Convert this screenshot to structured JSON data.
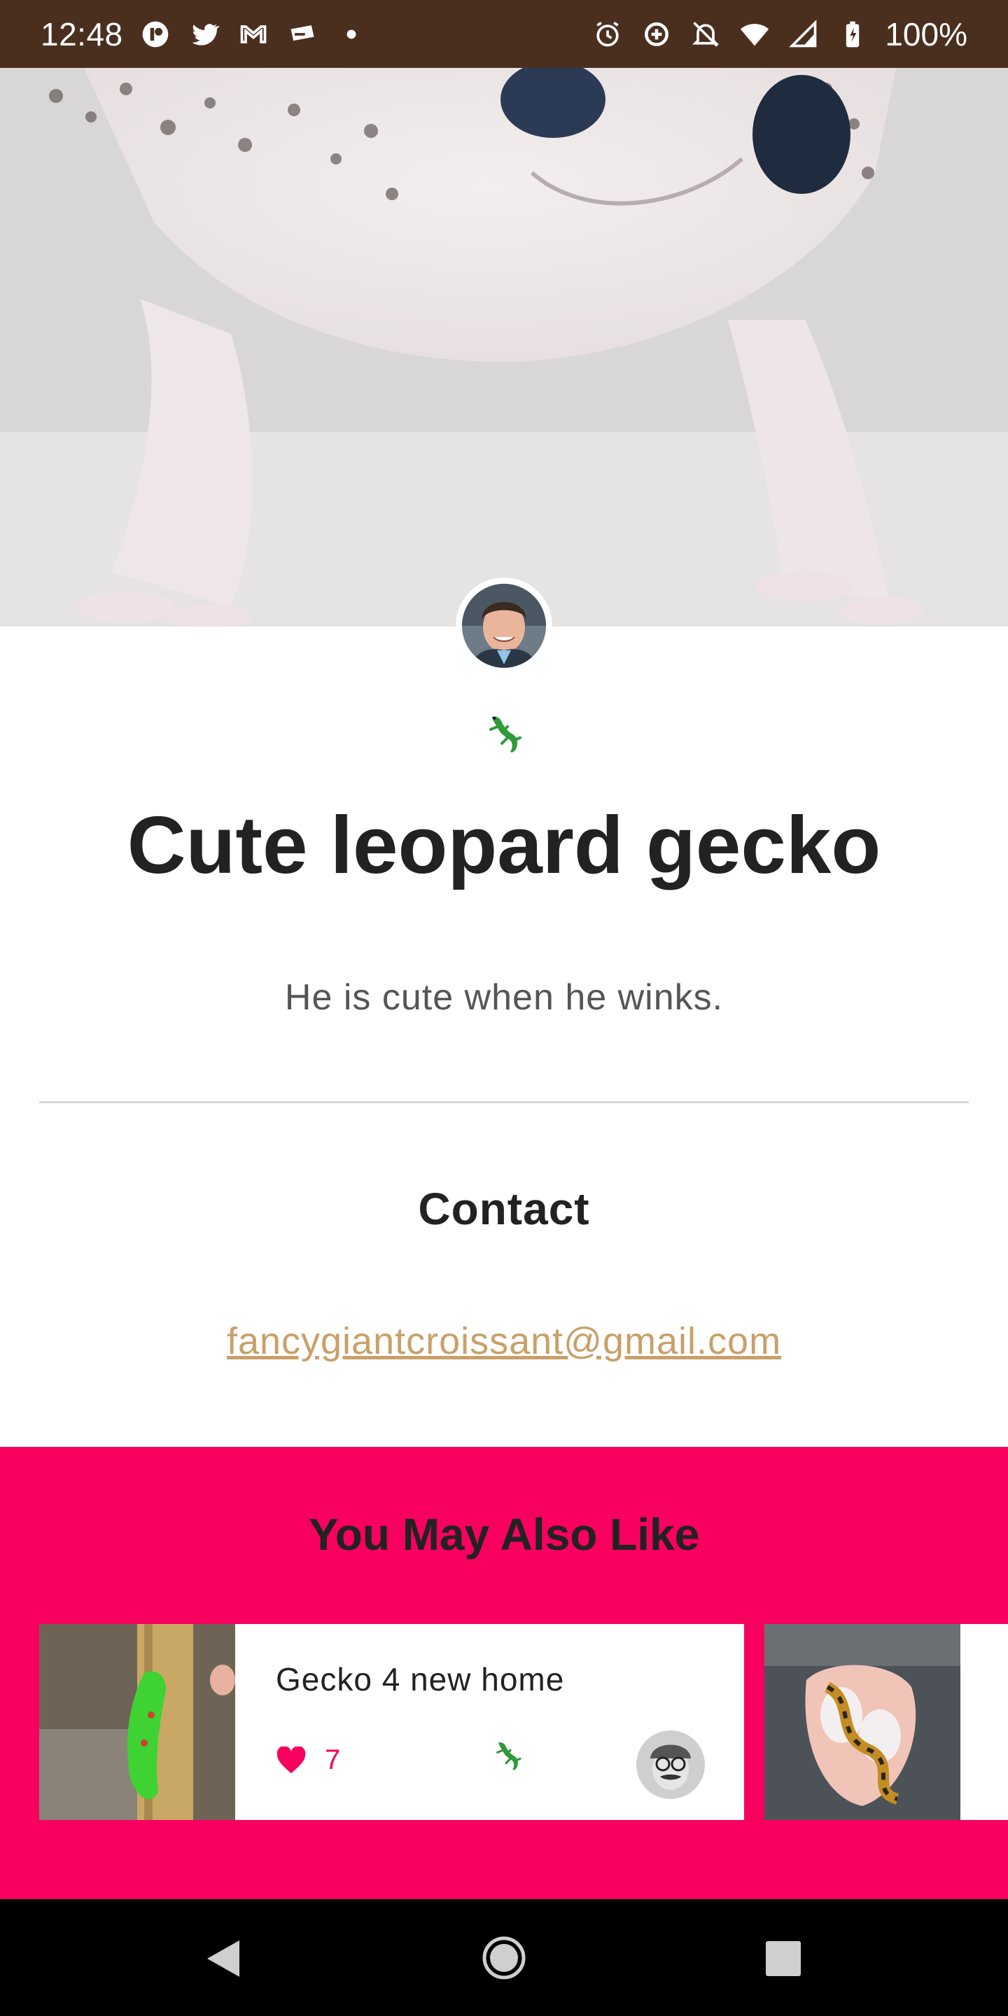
{
  "status_bar": {
    "time": "12:48",
    "battery": "100%",
    "left_icons": [
      "app-icon",
      "twitter-icon",
      "gmail-icon",
      "cast-icon",
      "dot-icon"
    ],
    "right_icons": [
      "alarm-icon",
      "data-saver-icon",
      "notifications-off-icon",
      "wifi-icon",
      "signal-icon",
      "battery-charging-icon"
    ]
  },
  "post": {
    "title": "Cute leopard gecko",
    "description": "He is cute when he winks.",
    "category_icon": "lizard-emoji"
  },
  "contact": {
    "heading": "Contact",
    "email": "fancygiantcroissant@gmail.com"
  },
  "recommendations": {
    "heading": "You May Also Like",
    "items": [
      {
        "title": "Gecko 4 new home",
        "likes": "7"
      },
      {
        "title": "",
        "likes": ""
      }
    ]
  },
  "colors": {
    "accent": "#f7005f",
    "status_bar": "#4a2f1f",
    "link": "#c9a06a"
  }
}
